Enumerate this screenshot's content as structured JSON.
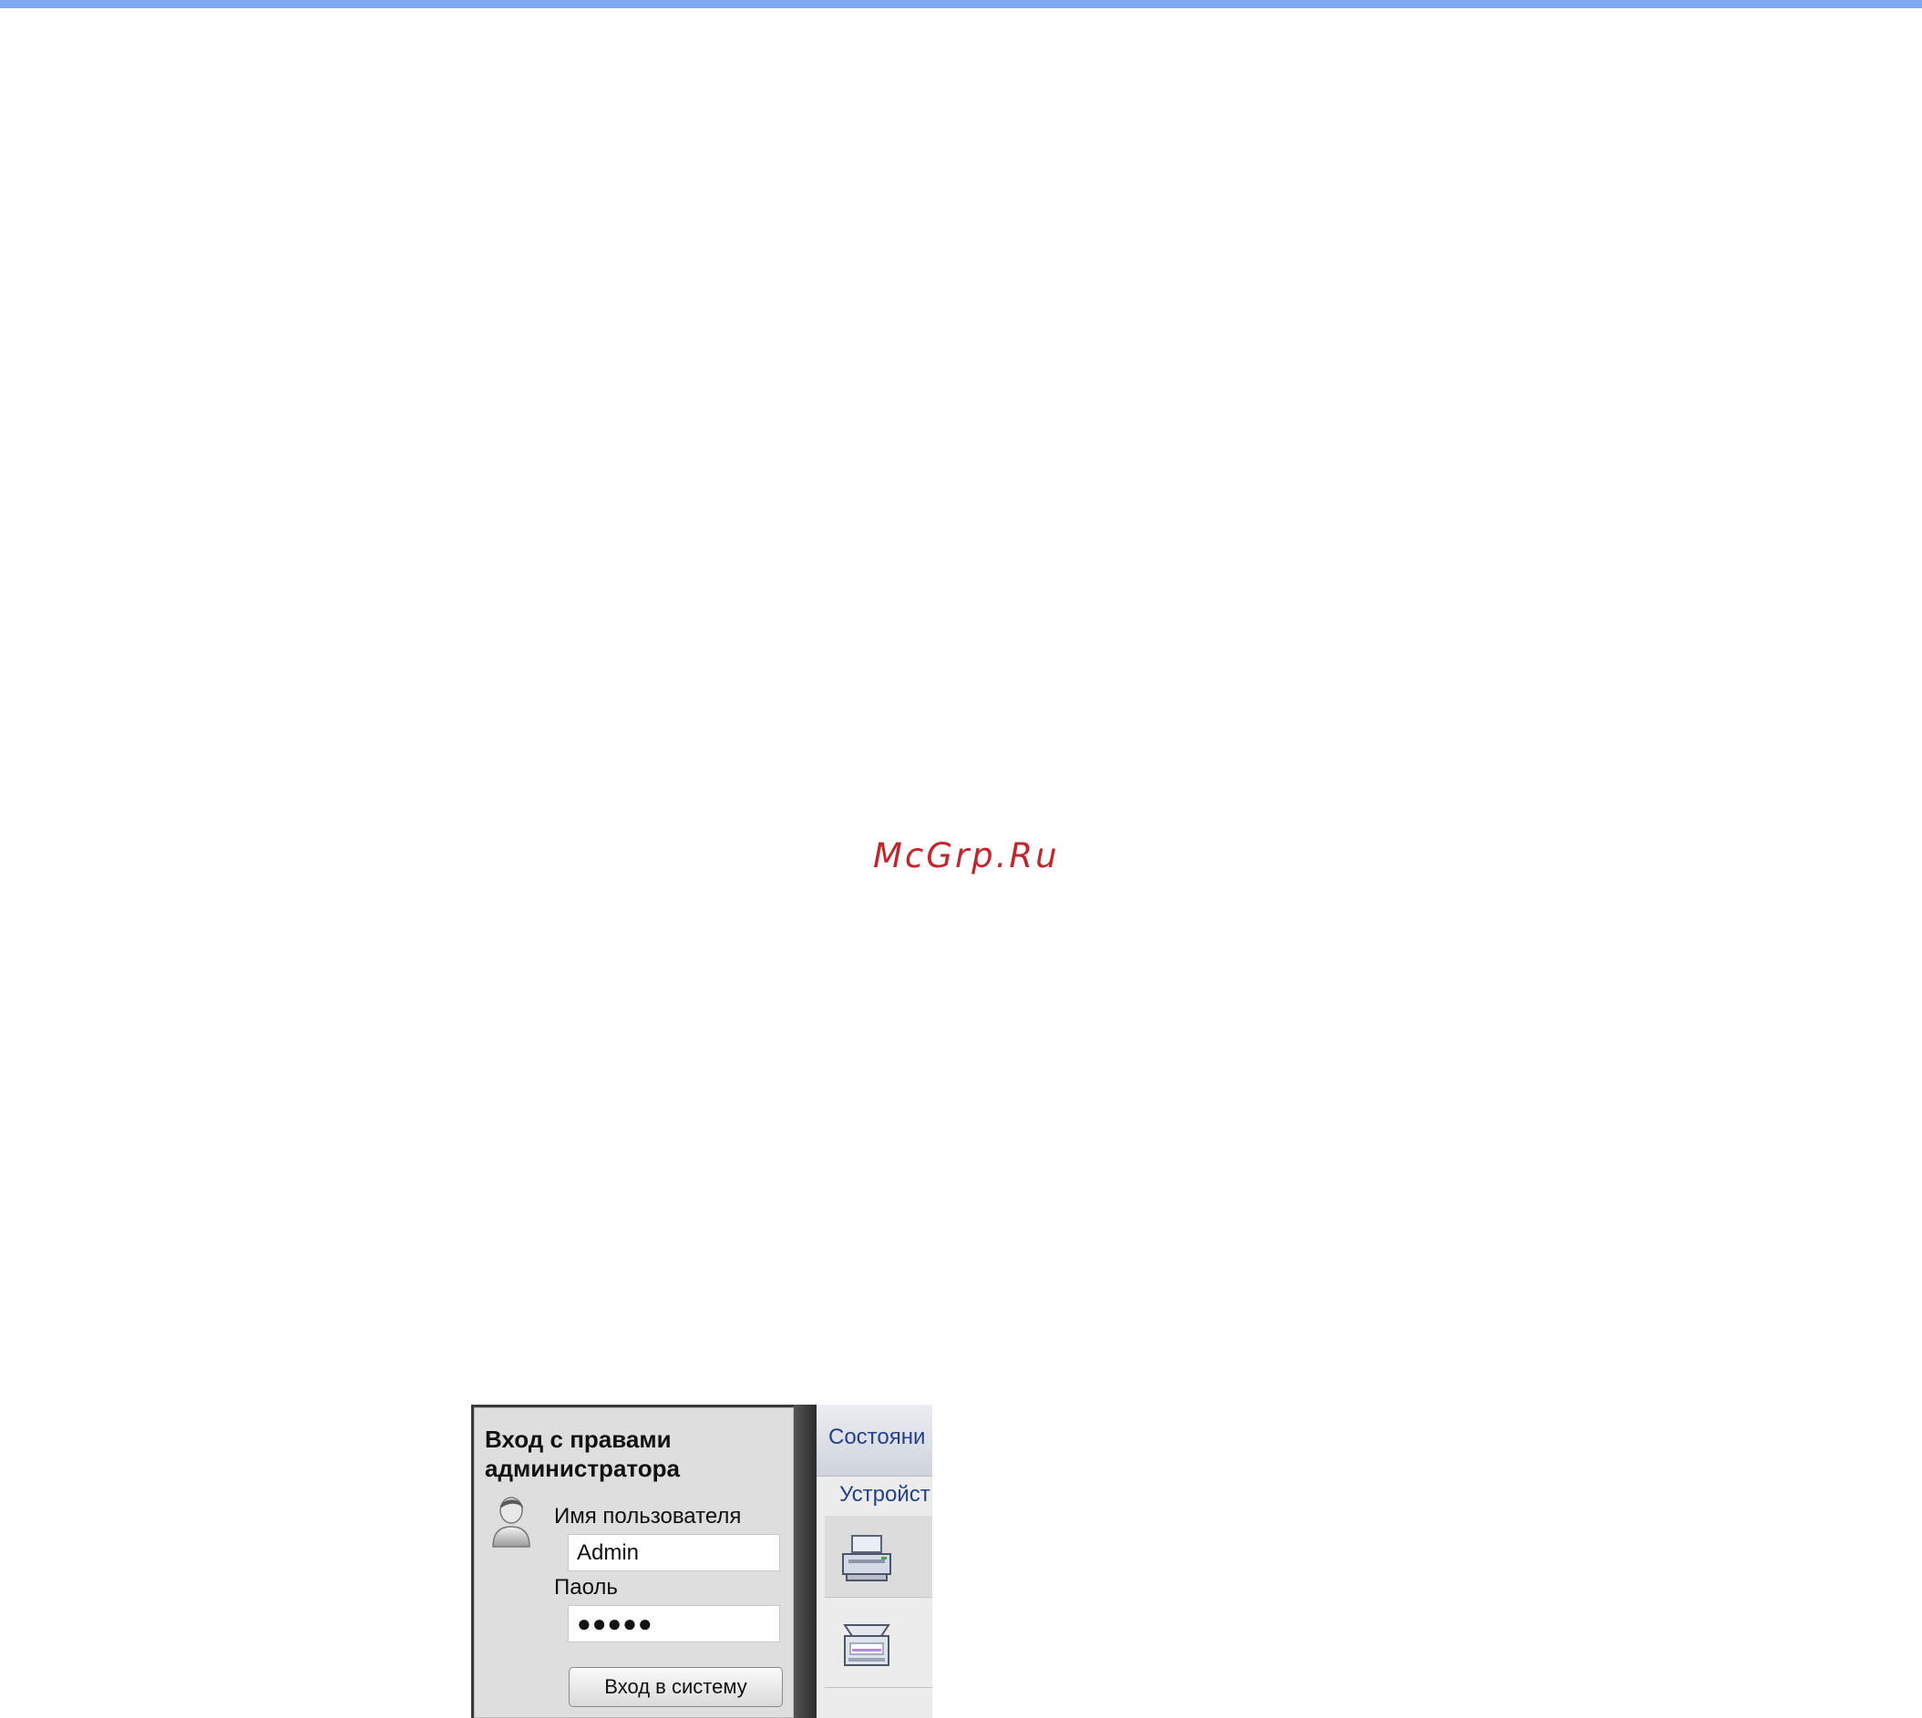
{
  "watermark": "McGrp.Ru",
  "login": {
    "title": "Вход с правами администратора",
    "username_label": "Имя пользователя",
    "username_value": "Admin",
    "password_label": "Паоль",
    "password_value": "●●●●●",
    "login_button": "Вход в систему"
  },
  "right_panel": {
    "status_tab": "Состояни",
    "device_link": "Устройст"
  },
  "icons": {
    "avatar": "user-avatar-icon",
    "printer": "printer-icon",
    "scanner": "scanner-icon"
  },
  "colors": {
    "top_bar": "#7faaf2",
    "watermark": "#c0262d",
    "link_blue": "#25408f"
  }
}
